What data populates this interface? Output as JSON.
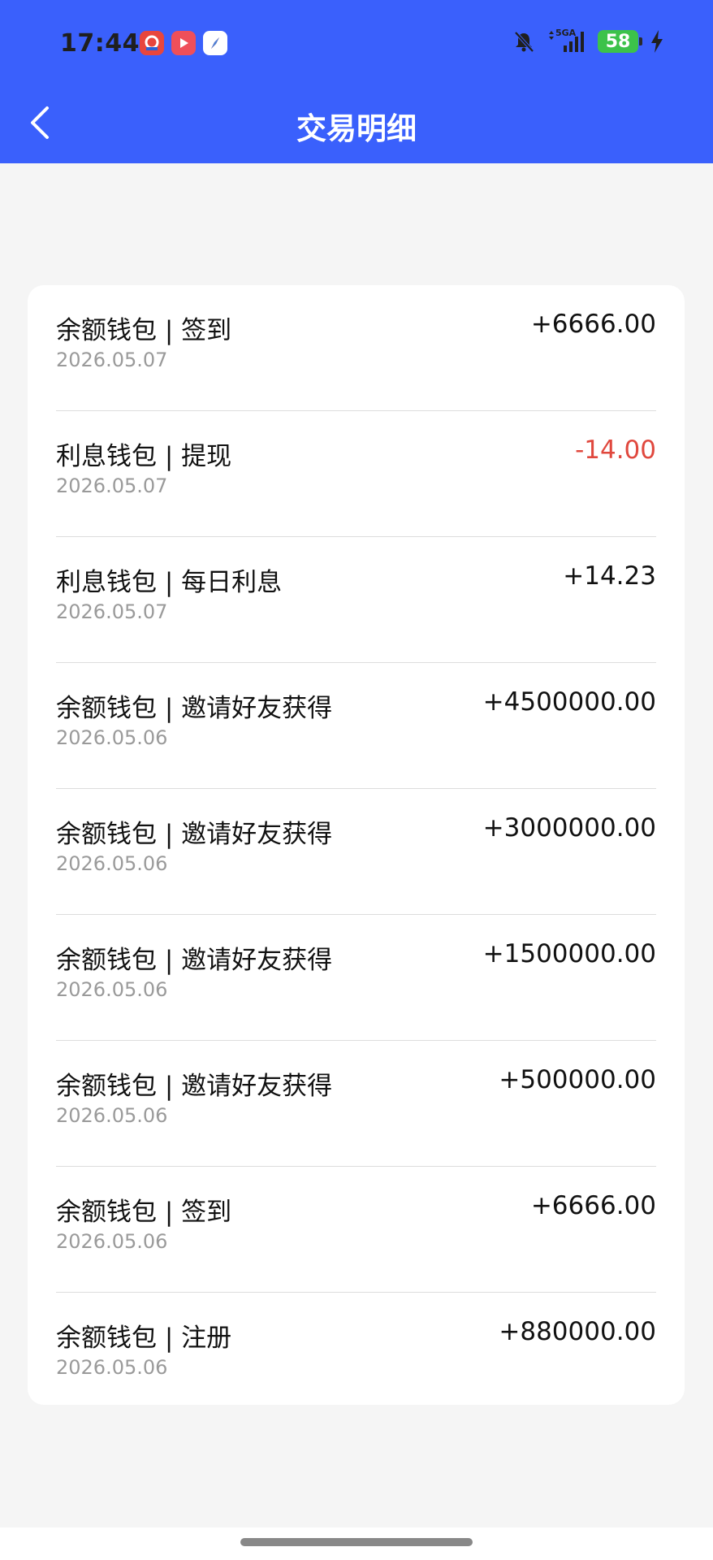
{
  "status_bar": {
    "time": "17:44",
    "network_label": "5GA",
    "battery": "58"
  },
  "nav": {
    "title": "交易明细"
  },
  "colors": {
    "header": "#3a60fc",
    "negative": "#e0483e",
    "battery": "#3cc24a"
  },
  "transactions": [
    {
      "title": "余额钱包 | 签到",
      "date": "2026.05.07",
      "amount": "+6666.00",
      "negative": false
    },
    {
      "title": "利息钱包 | 提现",
      "date": "2026.05.07",
      "amount": "-14.00",
      "negative": true
    },
    {
      "title": "利息钱包 | 每日利息",
      "date": "2026.05.07",
      "amount": "+14.23",
      "negative": false
    },
    {
      "title": "余额钱包 | 邀请好友获得",
      "date": "2026.05.06",
      "amount": "+4500000.00",
      "negative": false
    },
    {
      "title": "余额钱包 | 邀请好友获得",
      "date": "2026.05.06",
      "amount": "+3000000.00",
      "negative": false
    },
    {
      "title": "余额钱包 | 邀请好友获得",
      "date": "2026.05.06",
      "amount": "+1500000.00",
      "negative": false
    },
    {
      "title": "余额钱包 | 邀请好友获得",
      "date": "2026.05.06",
      "amount": "+500000.00",
      "negative": false
    },
    {
      "title": "余额钱包 | 签到",
      "date": "2026.05.06",
      "amount": "+6666.00",
      "negative": false
    },
    {
      "title": "余额钱包 | 注册",
      "date": "2026.05.06",
      "amount": "+880000.00",
      "negative": false
    }
  ]
}
